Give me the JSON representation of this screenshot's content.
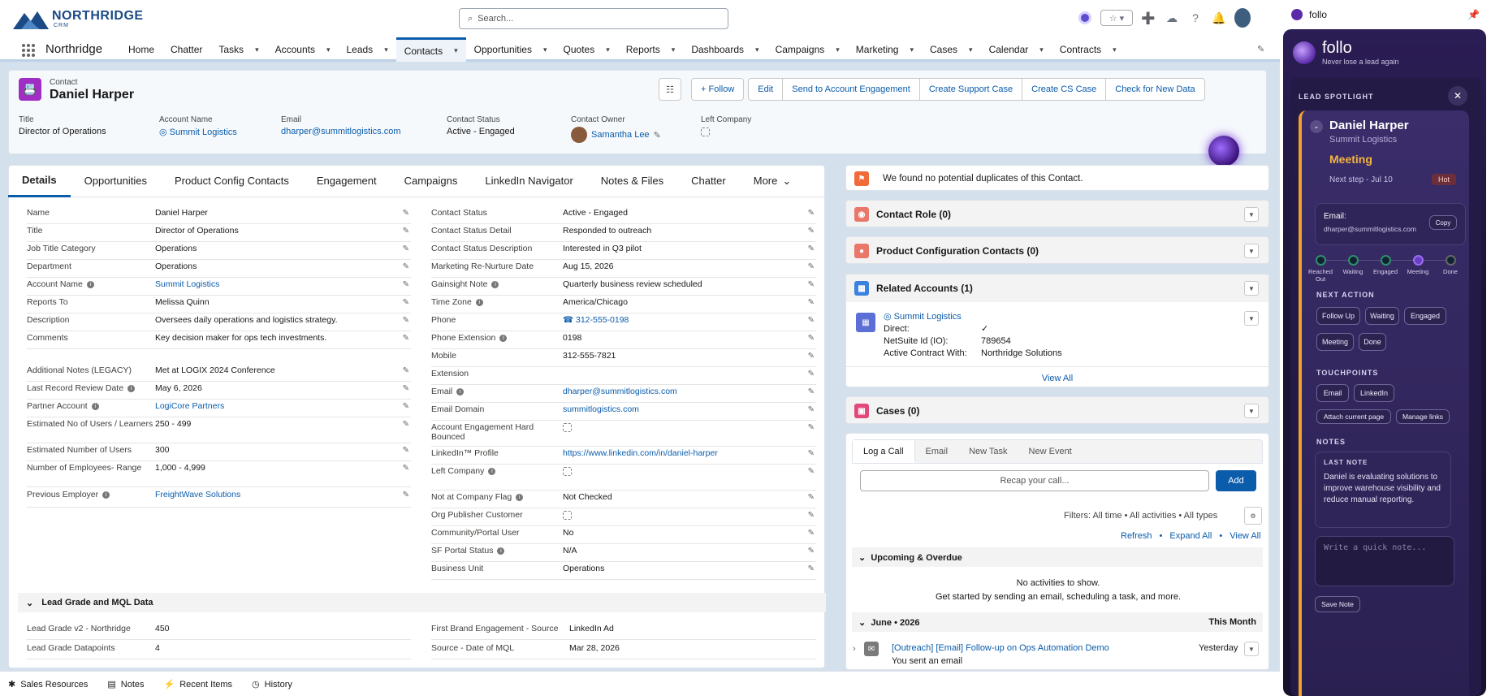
{
  "brand": {
    "name": "NORTHRIDGE",
    "sub": "CRM"
  },
  "search": {
    "placeholder": "Search..."
  },
  "nav": {
    "app": "Northridge",
    "items": [
      "Home",
      "Chatter",
      "Tasks",
      "Accounts",
      "Leads",
      "Contacts",
      "Opportunities",
      "Quotes",
      "Reports",
      "Dashboards",
      "Campaigns",
      "Marketing",
      "Cases",
      "Calendar",
      "Contracts"
    ]
  },
  "header": {
    "type": "Contact",
    "name": "Daniel Harper",
    "actions": [
      "Follow",
      "Edit",
      "Send to Account Engagement",
      "Create Support Case",
      "Create CS Case",
      "Check for New Data"
    ],
    "fields": {
      "title_l": "Title",
      "title_v": "Director of Operations",
      "acct_l": "Account Name",
      "acct_v": "Summit Logistics",
      "email_l": "Email",
      "email_v": "dharper@summitlogistics.com",
      "status_l": "Contact Status",
      "status_v": "Active - Engaged",
      "owner_l": "Contact Owner",
      "owner_v": "Samantha Lee",
      "left_l": "Left Company"
    }
  },
  "tabs": [
    "Details",
    "Opportunities",
    "Product Config Contacts",
    "Engagement",
    "Campaigns",
    "LinkedIn Navigator",
    "Notes & Files",
    "Chatter",
    "More"
  ],
  "left_fields": [
    [
      "Name",
      "Daniel Harper"
    ],
    [
      "Title",
      "Director of Operations"
    ],
    [
      "Job Title Category",
      "Operations"
    ],
    [
      "Department",
      "Operations"
    ],
    [
      "Account Name",
      "Summit Logistics"
    ],
    [
      "Reports To",
      "Melissa Quinn"
    ],
    [
      "Description",
      "Oversees daily operations and logistics strategy."
    ],
    [
      "Comments",
      "Key decision maker for ops tech investments."
    ],
    [
      "Additional Notes (LEGACY)",
      "Met at LOGIX 2024 Conference"
    ],
    [
      "Last Record Review Date",
      "May 6, 2026"
    ],
    [
      "Partner Account",
      "LogiCore Partners"
    ],
    [
      "Estimated No of Users / Learners",
      "250 - 499"
    ],
    [
      "Estimated Number of Users",
      "300"
    ],
    [
      "Number of Employees- Range",
      "1,000 - 4,999"
    ],
    [
      "Previous Employer",
      "FreightWave Solutions"
    ]
  ],
  "right_fields": [
    [
      "Contact Status",
      "Active - Engaged"
    ],
    [
      "Contact Status Detail",
      "Responded to outreach"
    ],
    [
      "Contact Status Description",
      "Interested in Q3 pilot"
    ],
    [
      "Marketing Re-Nurture Date",
      "Aug 15, 2026"
    ],
    [
      "Gainsight Note",
      "Quarterly business review scheduled"
    ],
    [
      "Time Zone",
      "America/Chicago"
    ],
    [
      "Phone",
      "312-555-0198"
    ],
    [
      "Phone Extension",
      "0198"
    ],
    [
      "Mobile",
      "312-555-7821"
    ],
    [
      "Extension",
      ""
    ],
    [
      "Email",
      "dharper@summitlogistics.com"
    ],
    [
      "Email Domain",
      "summitlogistics.com"
    ],
    [
      "Account Engagement Hard Bounced",
      ""
    ],
    [
      "LinkedIn™ Profile",
      "https://www.linkedin.com/in/daniel-harper"
    ],
    [
      "Left Company",
      ""
    ],
    [
      "Not at Company Flag",
      "Not Checked"
    ],
    [
      "Org Publisher Customer",
      ""
    ],
    [
      "Community/Portal User",
      "No"
    ],
    [
      "SF Portal Status",
      "N/A"
    ],
    [
      "Business Unit",
      "Operations"
    ]
  ],
  "lead_grade": {
    "title": "Lead Grade and MQL Data",
    "rows": [
      [
        "Lead Grade v2 - Northridge",
        "450",
        "First Brand Engagement - Source",
        "LinkedIn Ad"
      ],
      [
        "Lead Grade Datapoints",
        "4",
        "Source - Date of MQL",
        "Mar 28, 2026"
      ]
    ]
  },
  "right": {
    "dup": "We found no potential duplicates of this Contact.",
    "role": "Contact Role (0)",
    "pcc": "Product Configuration Contacts (0)",
    "rel": "Related Accounts (1)",
    "rel_acct": "Summit Logistics",
    "direct_l": "Direct:",
    "ns_l": "NetSuite Id (IO):",
    "ns_v": "789654",
    "ac_l": "Active Contract With:",
    "ac_v": "Northridge Solutions",
    "view_all": "View All",
    "cases": "Cases (0)",
    "log_tabs": [
      "Log a Call",
      "Email",
      "New Task",
      "New Event"
    ],
    "recap": "Recap your call...",
    "add": "Add",
    "filters": "Filters: All time  •  All activities  •  All types",
    "refresh": "Refresh",
    "expand": "Expand All",
    "view_all2": "View All",
    "upcoming": "Upcoming & Overdue",
    "no_act": "No activities to show.",
    "get_started": "Get started by sending an email, scheduling a task, and more.",
    "month": "June • 2026",
    "this_month": "This Month",
    "act_title": "[Outreach] [Email] Follow-up on Ops Automation Demo",
    "act_when": "Yesterday",
    "act_sub": "You sent an email"
  },
  "util": [
    "Sales Resources",
    "Notes",
    "Recent Items",
    "History"
  ],
  "follo": {
    "top": "follo",
    "title": "follo",
    "tag": "Never lose a lead again",
    "spot": "LEAD SPOTLIGHT",
    "lead_name": "Daniel Harper",
    "lead_co": "Summit Logistics",
    "stage": "Meeting",
    "next": "Next step - Jul 10",
    "hot": "Hot",
    "email_l": "Email:",
    "email_v": "dharper@summitlogistics.com",
    "copy": "Copy",
    "steps": [
      "Reached Out",
      "Waiting",
      "Engaged",
      "Meeting",
      "Done"
    ],
    "next_action": "NEXT ACTION",
    "actions": [
      "Follow Up",
      "Waiting",
      "Engaged",
      "Meeting",
      "Done"
    ],
    "touch": "TOUCHPOINTS",
    "touches": [
      "Email",
      "LinkedIn"
    ],
    "attach": "Attach current page",
    "manage": "Manage links",
    "notes": "NOTES",
    "last_note": "LAST NOTE",
    "note": "Daniel is evaluating solutions to improve warehouse visibility and reduce manual reporting.",
    "quick": "Write a quick note...",
    "save": "Save Note"
  },
  "colors": {
    "brand": "#0b5cab",
    "accent": "#f4a12b",
    "panel": "#1c1438"
  }
}
